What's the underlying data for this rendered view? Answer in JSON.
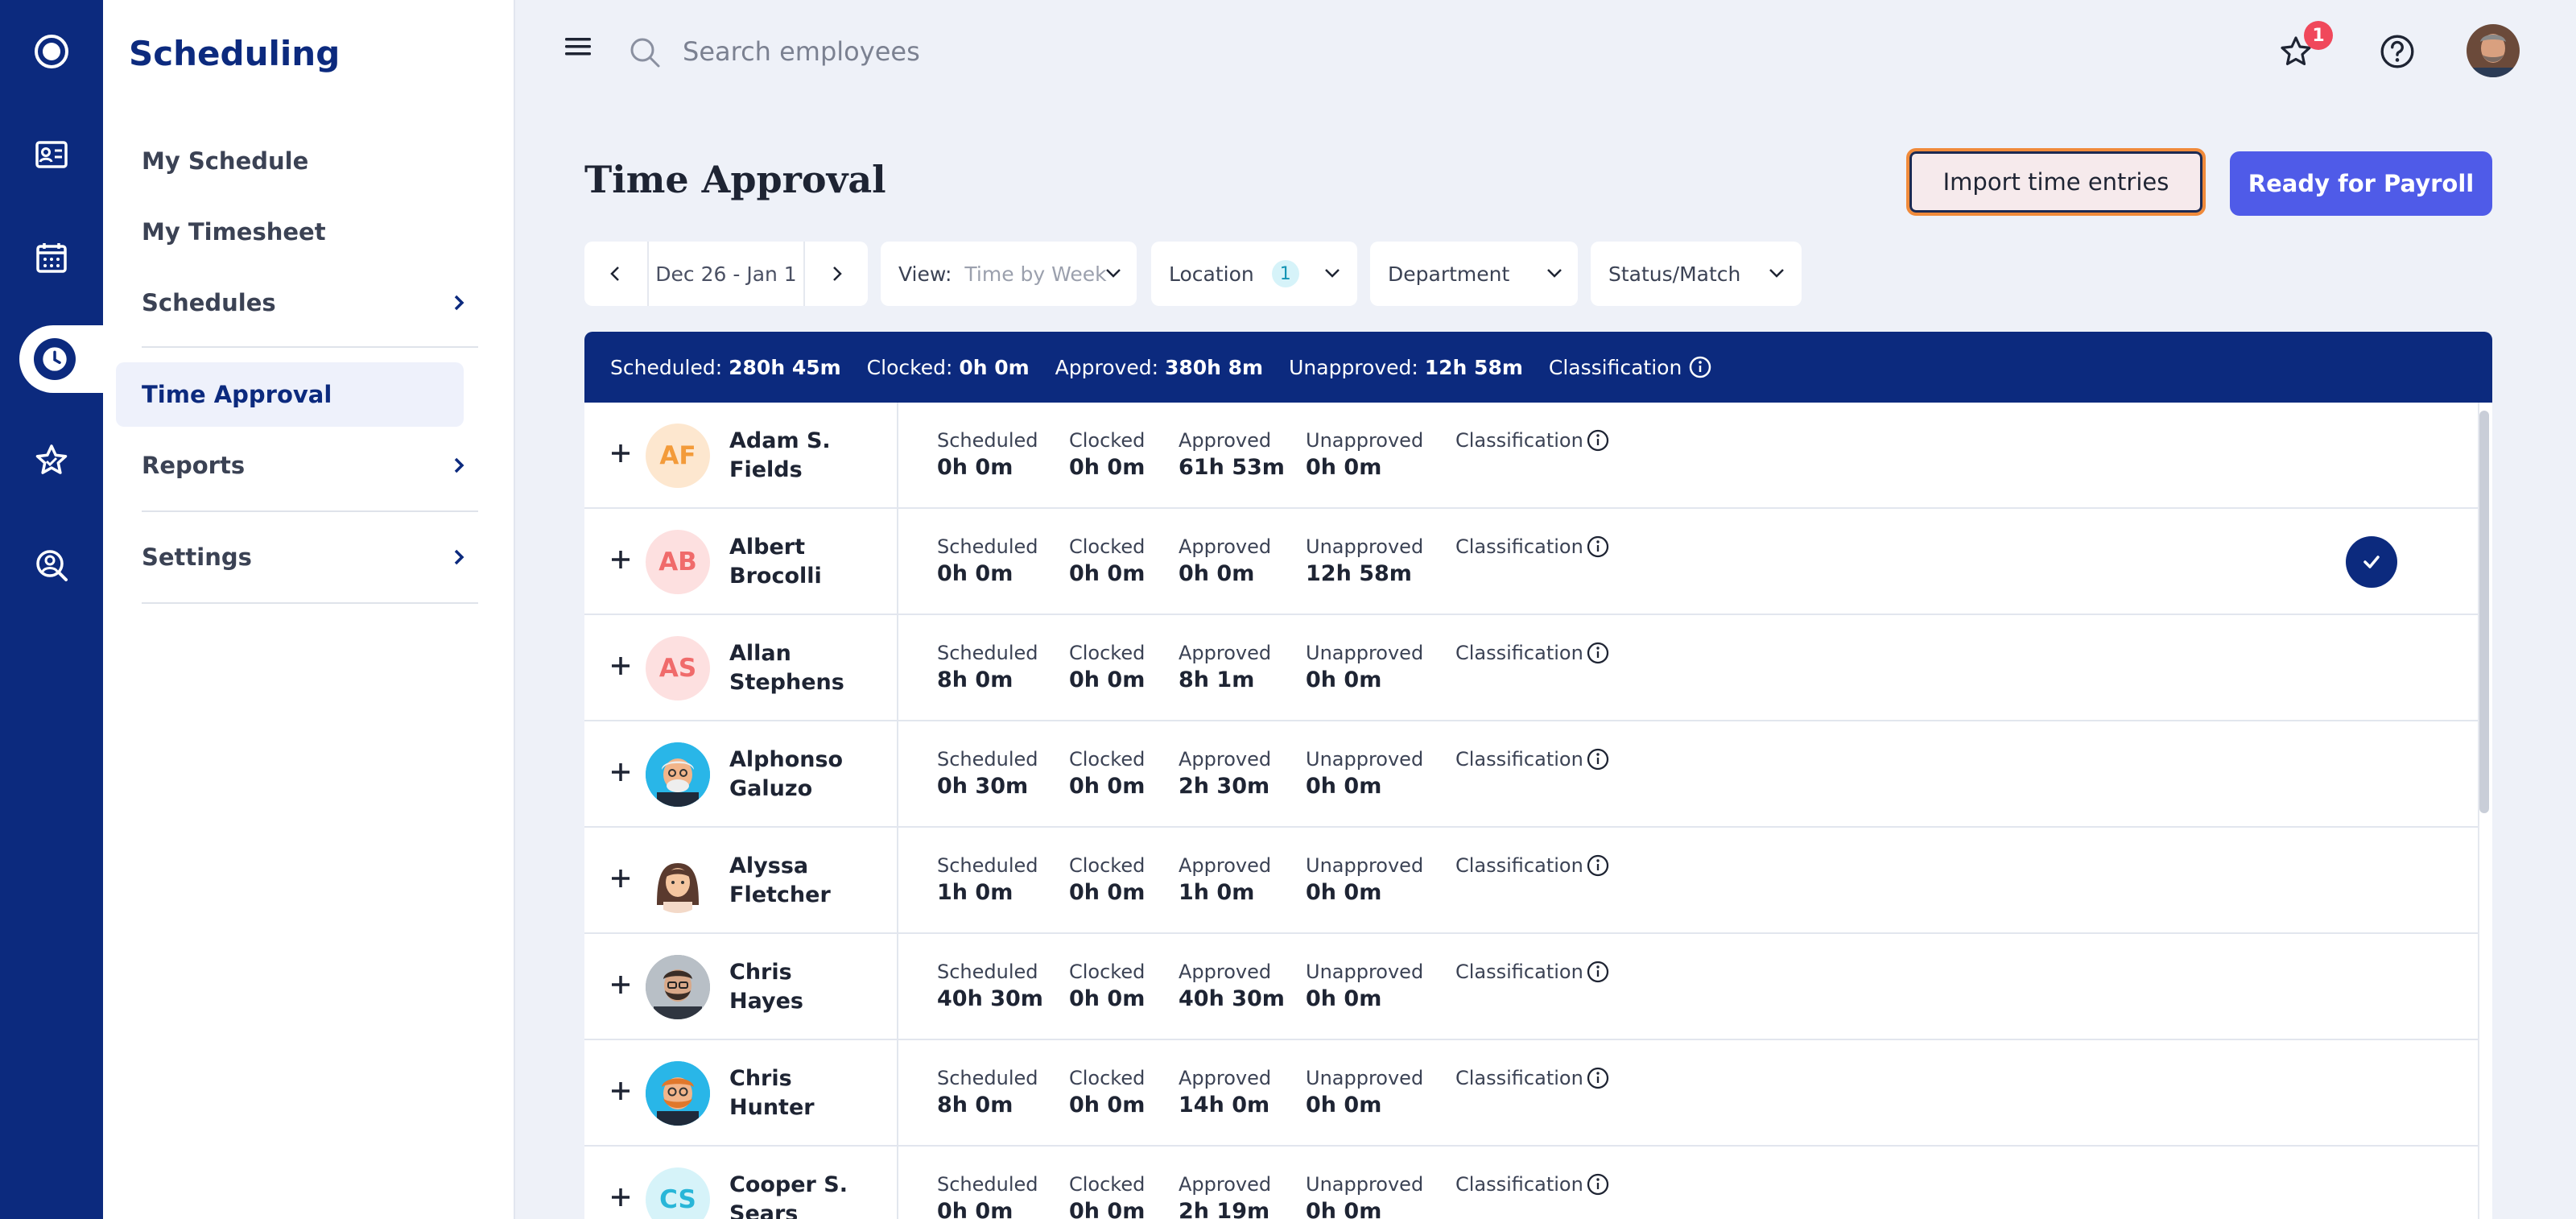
{
  "sidebar": {
    "brand": "Scheduling",
    "items": [
      {
        "label": "My Schedule"
      },
      {
        "label": "My Timesheet"
      },
      {
        "label": "Schedules"
      },
      {
        "label": "Time Approval"
      },
      {
        "label": "Reports"
      },
      {
        "label": "Settings"
      }
    ]
  },
  "search": {
    "placeholder": "Search employees"
  },
  "notifications": {
    "count": "1"
  },
  "page": {
    "title": "Time Approval",
    "import_label": "Import time entries",
    "payroll_label": "Ready for Payroll"
  },
  "filters": {
    "date_range": "Dec 26 - Jan 1",
    "view_label": "View:",
    "view_value": "Time by Week",
    "location_label": "Location",
    "location_count": "1",
    "department_label": "Department",
    "status_label": "Status/Match"
  },
  "summary": {
    "scheduled_label": "Scheduled:",
    "scheduled": "280h 45m",
    "clocked_label": "Clocked:",
    "clocked": "0h 0m",
    "approved_label": "Approved:",
    "approved": "380h 8m",
    "unapproved_label": "Unapproved:",
    "unapproved": "12h 58m",
    "classification_label": "Classification"
  },
  "columns": {
    "scheduled": "Scheduled",
    "clocked": "Clocked",
    "approved": "Approved",
    "unapproved": "Unapproved",
    "classification": "Classification"
  },
  "employees": [
    {
      "initials": "AF",
      "first": "Adam S.",
      "last": "Fields",
      "scheduled": "0h 0m",
      "clocked": "0h 0m",
      "approved": "61h 53m",
      "unapproved": "0h 0m"
    },
    {
      "initials": "AB",
      "first": "Albert",
      "last": "Brocolli",
      "scheduled": "0h 0m",
      "clocked": "0h 0m",
      "approved": "0h 0m",
      "unapproved": "12h 58m"
    },
    {
      "initials": "AS",
      "first": "Allan",
      "last": "Stephens",
      "scheduled": "8h 0m",
      "clocked": "0h 0m",
      "approved": "8h 1m",
      "unapproved": "0h 0m"
    },
    {
      "initials": "",
      "first": "Alphonso",
      "last": "Galuzo",
      "scheduled": "0h 30m",
      "clocked": "0h 0m",
      "approved": "2h 30m",
      "unapproved": "0h 0m"
    },
    {
      "initials": "",
      "first": "Alyssa",
      "last": "Fletcher",
      "scheduled": "1h 0m",
      "clocked": "0h 0m",
      "approved": "1h 0m",
      "unapproved": "0h 0m"
    },
    {
      "initials": "",
      "first": "Chris",
      "last": "Hayes",
      "scheduled": "40h 30m",
      "clocked": "0h 0m",
      "approved": "40h 30m",
      "unapproved": "0h 0m"
    },
    {
      "initials": "",
      "first": "Chris",
      "last": "Hunter",
      "scheduled": "8h 0m",
      "clocked": "0h 0m",
      "approved": "14h 0m",
      "unapproved": "0h 0m"
    },
    {
      "initials": "CS",
      "first": "Cooper S.",
      "last": "Sears",
      "scheduled": "0h 0m",
      "clocked": "0h 0m",
      "approved": "2h 19m",
      "unapproved": "0h 0m"
    }
  ],
  "colors": {
    "brand": "#0c2a7e",
    "primary_button": "#4f5be8",
    "focus_ring": "#f08a3a",
    "badge": "#f0485b"
  }
}
